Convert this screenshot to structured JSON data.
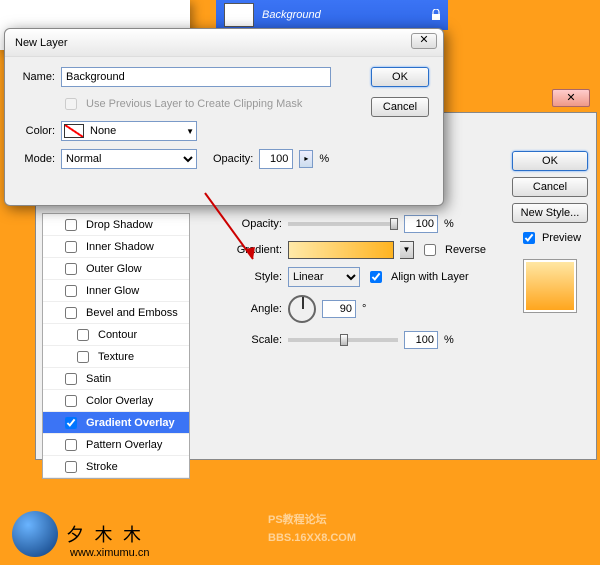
{
  "layers": {
    "active_name": "Background"
  },
  "new_layer": {
    "title": "New Layer",
    "name_label": "Name:",
    "name_value": "Background",
    "clip_label": "Use Previous Layer to Create Clipping Mask",
    "color_label": "Color:",
    "color_value": "None",
    "mode_label": "Mode:",
    "mode_value": "Normal",
    "opacity_label": "Opacity:",
    "opacity_value": "100",
    "percent": "%",
    "ok": "OK",
    "cancel": "Cancel",
    "close_glyph": "✕"
  },
  "layer_style": {
    "close_glyph": "✕",
    "styles": [
      {
        "label": "Drop Shadow",
        "checked": false
      },
      {
        "label": "Inner Shadow",
        "checked": false
      },
      {
        "label": "Outer Glow",
        "checked": false
      },
      {
        "label": "Inner Glow",
        "checked": false
      },
      {
        "label": "Bevel and Emboss",
        "checked": false
      },
      {
        "label": "Contour",
        "checked": false,
        "indent": true
      },
      {
        "label": "Texture",
        "checked": false,
        "indent": true
      },
      {
        "label": "Satin",
        "checked": false
      },
      {
        "label": "Color Overlay",
        "checked": false
      },
      {
        "label": "Gradient Overlay",
        "checked": true,
        "selected": true
      },
      {
        "label": "Pattern Overlay",
        "checked": false
      },
      {
        "label": "Stroke",
        "checked": false
      }
    ],
    "panel": {
      "opacity_label": "Opacity:",
      "opacity_value": "100",
      "gradient_label": "Gradient:",
      "reverse_label": "Reverse",
      "style_label": "Style:",
      "style_value": "Linear",
      "align_label": "Align with Layer",
      "angle_label": "Angle:",
      "angle_value": "90",
      "degree": "°",
      "scale_label": "Scale:",
      "scale_value": "100",
      "percent": "%"
    },
    "right": {
      "ok": "OK",
      "cancel": "Cancel",
      "new_style": "New Style...",
      "preview": "Preview"
    }
  },
  "watermark": {
    "brand_cn": "夕 木 木",
    "url": "www.ximumu.cn",
    "line1": "PS教程论坛",
    "line2": "BBS.16XX8.COM"
  }
}
